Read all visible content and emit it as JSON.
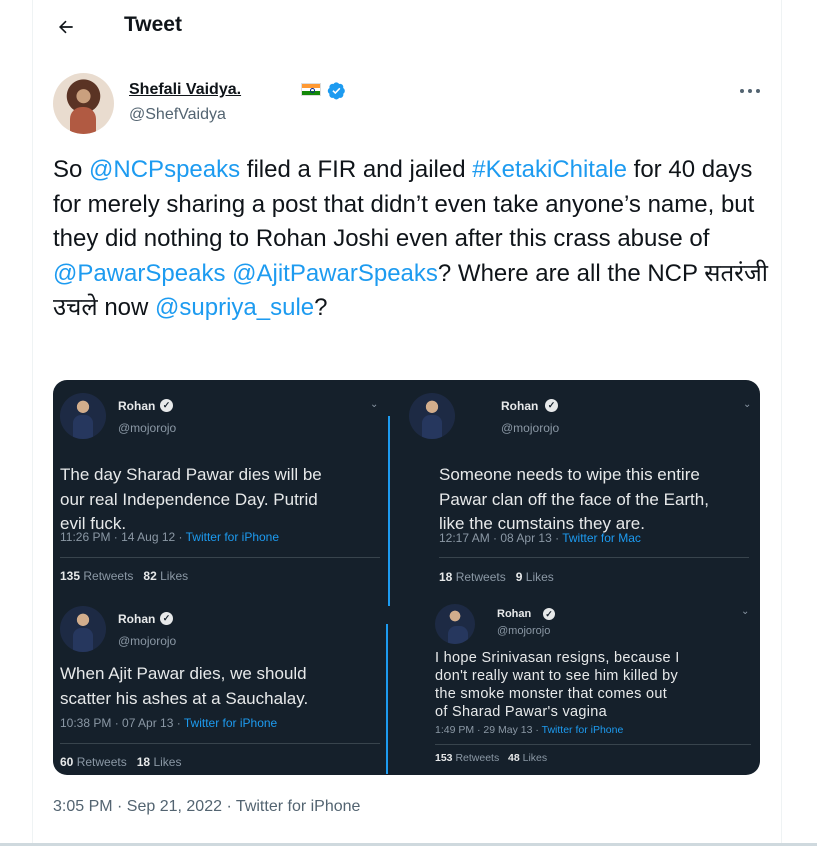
{
  "header": {
    "title": "Tweet",
    "back_icon": "arrow-left-icon"
  },
  "author": {
    "display_name": "Shefali Vaidya.",
    "flag_icon": "india-flag-icon",
    "verified_icon": "verified-badge-icon",
    "handle": "@ShefVaidya",
    "more_icon": "more-horizontal-icon"
  },
  "tweet": {
    "segments": [
      {
        "text": "So ",
        "link": false
      },
      {
        "text": "@NCPspeaks",
        "link": true
      },
      {
        "text": " filed a FIR and jailed ",
        "link": false
      },
      {
        "text": "#KetakiChitale",
        "link": true
      },
      {
        "text": " for 40 days for merely sharing a post that didn’t even take anyone’s name, but they did nothing to Rohan Joshi even after this crass abuse of ",
        "link": false
      },
      {
        "text": "@PawarSpeaks",
        "link": true
      },
      {
        "text": " ",
        "link": false
      },
      {
        "text": "@AjitPawarSpeaks",
        "link": true
      },
      {
        "text": "? Where are all the NCP सतरंजी उचले now ",
        "link": false
      },
      {
        "text": "@supriya_sule",
        "link": true
      },
      {
        "text": "?",
        "link": false
      }
    ]
  },
  "media": {
    "shots": [
      {
        "name": "Rohan",
        "handle": "@mojorojo",
        "body": [
          "The day Sharad Pawar dies will be",
          "our real Independence Day. Putrid",
          "evil fuck."
        ],
        "time": "11:26 PM · 14 Aug 12 · ",
        "source": "Twitter for iPhone",
        "retweets": "135",
        "retweets_label": "Retweets",
        "likes": "82",
        "likes_label": "Likes"
      },
      {
        "name": "Rohan",
        "handle": "@mojorojo",
        "body": [
          "Someone needs to wipe this entire",
          "Pawar clan off the face of the Earth,",
          "like the cumstains they are."
        ],
        "time": "12:17 AM · 08 Apr 13 · ",
        "source": "Twitter for Mac",
        "retweets": "18",
        "retweets_label": "Retweets",
        "likes": "9",
        "likes_label": "Likes"
      },
      {
        "name": "Rohan",
        "handle": "@mojorojo",
        "body": [
          "When Ajit Pawar dies, we should",
          "scatter his ashes at a Sauchalay."
        ],
        "time": "10:38 PM · 07 Apr 13 · ",
        "source": "Twitter for iPhone",
        "retweets": "60",
        "retweets_label": "Retweets",
        "likes": "18",
        "likes_label": "Likes"
      },
      {
        "name": "Rohan",
        "handle": "@mojorojo",
        "body": [
          "I hope Srinivasan resigns, because I",
          "don't really want to see him killed by",
          "the smoke monster that comes out",
          "of Sharad Pawar's vagina"
        ],
        "time": "1:49 PM · 29 May 13 · ",
        "source": "Twitter for iPhone",
        "retweets": "153",
        "retweets_label": "Retweets",
        "likes": "48",
        "likes_label": "Likes"
      }
    ]
  },
  "footer": {
    "timestamp": "3:05 PM · Sep 21, 2022 · Twitter for iPhone"
  }
}
